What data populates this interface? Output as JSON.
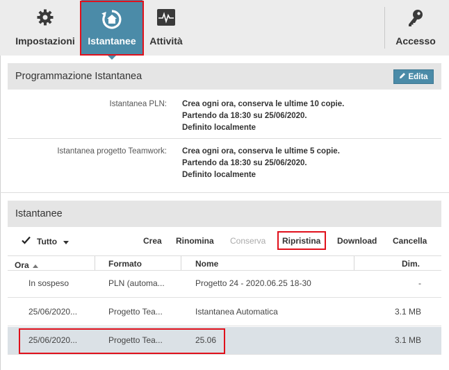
{
  "toolbar": {
    "settings_label": "Impostazioni",
    "snapshots_label": "Istantanee",
    "activity_label": "Attività",
    "access_label": "Accesso"
  },
  "schedule": {
    "title": "Programmazione Istantanea",
    "edit_label": "Edita",
    "pln_label": "Istantanea PLN:",
    "pln_lines": [
      "Crea ogni ora, conserva le ultime 10 copie.",
      "Partendo da 18:30 su 25/06/2020.",
      "Definito localmente"
    ],
    "teamwork_label": "Istantanea progetto Teamwork:",
    "teamwork_lines": [
      "Crea ogni ora, conserva le ultime 5 copie.",
      "Partendo da 18:30 su 25/06/2020.",
      "Definito localmente"
    ]
  },
  "snapshots": {
    "title": "Istantanee",
    "select_all_label": "Tutto",
    "actions": {
      "create": "Crea",
      "rename": "Rinomina",
      "keep": "Conserva",
      "restore": "Ripristina",
      "download": "Download",
      "delete": "Cancella"
    },
    "columns": {
      "time": "Ora",
      "format": "Formato",
      "name": "Nome",
      "size": "Dim."
    },
    "rows": [
      {
        "time": "In sospeso",
        "format": "PLN (automa...",
        "name": "Progetto 24 - 2020.06.25 18-30",
        "size": "-"
      },
      {
        "time": "25/06/2020...",
        "format": "Progetto Tea...",
        "name": "Istantanea Automatica",
        "size": "3.1 MB"
      },
      {
        "time": "25/06/2020...",
        "format": "Progetto Tea...",
        "name": "25.06",
        "size": "3.1 MB"
      }
    ]
  },
  "colors": {
    "accent": "#4b8ba8",
    "highlight": "#e0101b",
    "selected_row": "#dbe1e6"
  }
}
